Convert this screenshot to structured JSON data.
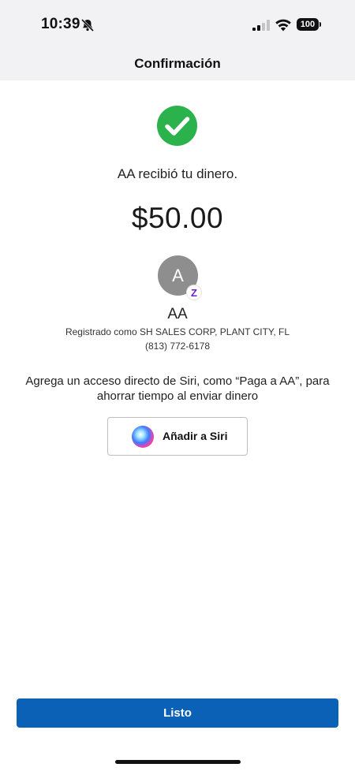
{
  "status_bar": {
    "time": "10:39",
    "battery": "100",
    "icons": [
      "bell-slash-icon",
      "cellular-signal-icon",
      "wifi-icon",
      "battery-icon"
    ]
  },
  "nav": {
    "title": "Confirmación"
  },
  "confirmation": {
    "icon": "check-circle-icon",
    "icon_color": "#2bb24c",
    "message": "AA recibió tu dinero.",
    "amount": "$50.00"
  },
  "recipient": {
    "avatar_initial": "A",
    "badge": "Z",
    "badge_color": "#6d1ed4",
    "name": "AA",
    "registered": "Registrado como SH SALES CORP, PLANT CITY, FL",
    "phone": "(813) 772-6178"
  },
  "siri": {
    "prompt": "Agrega un acceso directo de Siri, como “Paga a AA”, para ahorrar tiempo al enviar dinero",
    "button_label": "Añadir a Siri",
    "icon": "siri-icon"
  },
  "footer": {
    "done_label": "Listo",
    "accent": "#0b61b6"
  }
}
